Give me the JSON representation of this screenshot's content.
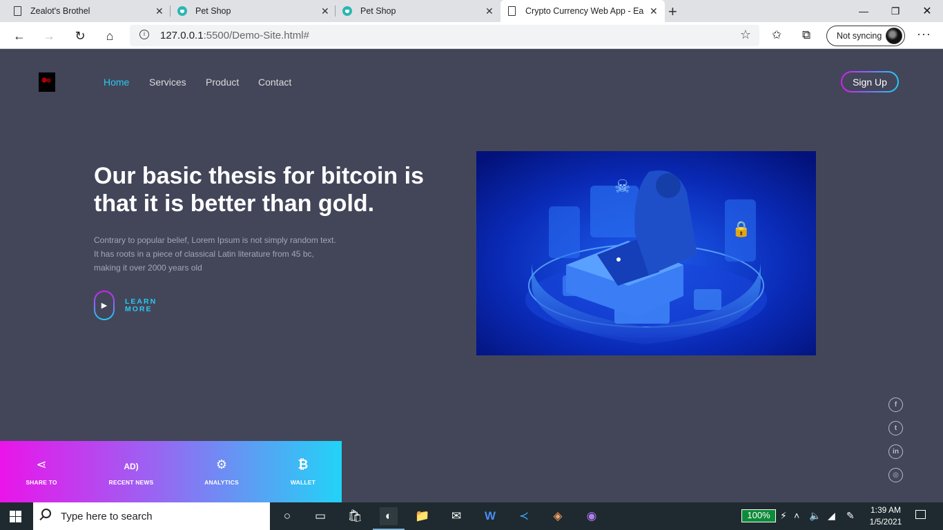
{
  "browser": {
    "tabs": [
      {
        "title": "Zealot's Brothel",
        "icon": "page-icon"
      },
      {
        "title": "Pet Shop",
        "icon": "pet-shop-icon"
      },
      {
        "title": "Pet Shop",
        "icon": "pet-shop-icon"
      },
      {
        "title": "Crypto Currency Web App - Easy",
        "icon": "page-icon",
        "active": true
      }
    ],
    "url_host": "127.0.0.1",
    "url_rest": ":5500/Demo-Site.html#",
    "profile_label": "Not syncing"
  },
  "site": {
    "nav": {
      "home": "Home",
      "services": "Services",
      "product": "Product",
      "contact": "Contact",
      "signup": "Sign Up"
    },
    "hero": {
      "headline": "Our basic thesis for bitcoin is that it is better than gold.",
      "paragraph": "Contrary to popular belief, Lorem Ipsum is not simply random text. It has roots in a piece of classical Latin literature from 45 bc, making it over 2000 years old",
      "learn_more": "LEARN MORE",
      "image_alt": "hacker at laptop security illustration"
    },
    "social": [
      "facebook-icon",
      "twitter-icon",
      "linkedin-icon",
      "instagram-icon"
    ],
    "features": [
      {
        "label": "SHARE TO",
        "icon": "share-icon"
      },
      {
        "label": "RECENT NEWS",
        "icon": "ad-icon"
      },
      {
        "label": "ANALYTICS",
        "icon": "gear-icon"
      },
      {
        "label": "WALLET",
        "icon": "bitcoin-icon"
      }
    ],
    "colors": {
      "background": "#434659",
      "accent_cyan": "#29c9f4",
      "accent_magenta": "#d61bf0"
    }
  },
  "taskbar": {
    "search_placeholder": "Type here to search",
    "battery": "100%",
    "time": "1:39 AM",
    "date": "1/5/2021"
  }
}
